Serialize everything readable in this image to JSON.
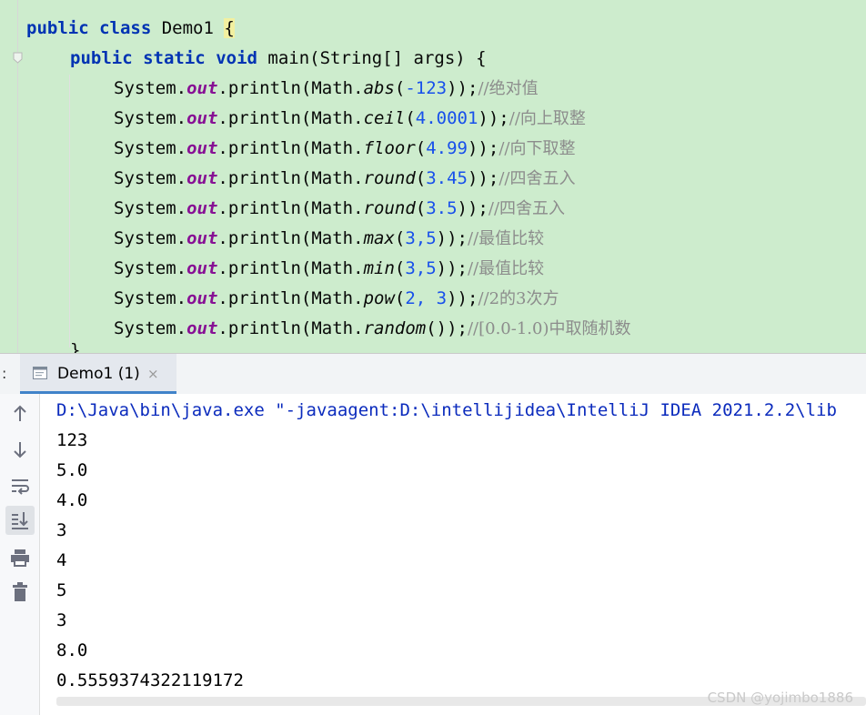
{
  "editor": {
    "class_decl": {
      "kw_public": "public",
      "kw_class": "class",
      "name": " Demo1 ",
      "brace": "{"
    },
    "method_decl": {
      "kw_public": "public",
      "kw_static": "static",
      "kw_void": "void",
      "sig": " main(String[] args) {"
    },
    "statements": [
      {
        "pre": "System.",
        "field": "out",
        "mid": ".println(Math.",
        "method": "abs",
        "open": "(",
        "args": "-123",
        "close": "));",
        "comment": "//绝对值"
      },
      {
        "pre": "System.",
        "field": "out",
        "mid": ".println(Math.",
        "method": "ceil",
        "open": "(",
        "args": "4.0001",
        "close": "));",
        "comment": "//向上取整"
      },
      {
        "pre": "System.",
        "field": "out",
        "mid": ".println(Math.",
        "method": "floor",
        "open": "(",
        "args": "4.99",
        "close": "));",
        "comment": "//向下取整"
      },
      {
        "pre": "System.",
        "field": "out",
        "mid": ".println(Math.",
        "method": "round",
        "open": "(",
        "args": "3.45",
        "close": "));",
        "comment": "//四舍五入"
      },
      {
        "pre": "System.",
        "field": "out",
        "mid": ".println(Math.",
        "method": "round",
        "open": "(",
        "args": "3.5",
        "close": "));",
        "comment": "//四舍五入"
      },
      {
        "pre": "System.",
        "field": "out",
        "mid": ".println(Math.",
        "method": "max",
        "open": "(",
        "args": "3,5",
        "close": "));",
        "comment": "//最值比较"
      },
      {
        "pre": "System.",
        "field": "out",
        "mid": ".println(Math.",
        "method": "min",
        "open": "(",
        "args": "3,5",
        "close": "));",
        "comment": "//最值比较"
      },
      {
        "pre": "System.",
        "field": "out",
        "mid": ".println(Math.",
        "method": "pow",
        "open": "(",
        "args": "2, 3",
        "close": "));",
        "comment": "//2的3次方"
      },
      {
        "pre": "System.",
        "field": "out",
        "mid": ".println(Math.",
        "method": "random",
        "open": "(",
        "args": "",
        "close": "));",
        "comment": "//[0.0-1.0)中取随机数"
      }
    ],
    "partial_close": "}",
    "colors": {
      "background": "#cdeccd",
      "keyword": "#0033b3",
      "field": "#871094",
      "number": "#1750eb",
      "comment": "#8c8c8c"
    }
  },
  "run_panel": {
    "left_fragment": ":",
    "tab_label": "Demo1 (1)",
    "tab_close": "×",
    "tab_icon": "console-window-icon",
    "toolbar_icons": [
      "arrow-up-icon",
      "arrow-down-icon",
      "soft-wrap-icon",
      "scroll-to-end-icon",
      "print-icon",
      "trash-icon"
    ],
    "command": "D:\\Java\\bin\\java.exe \"-javaagent:D:\\intellijidea\\IntelliJ IDEA 2021.2.2\\lib",
    "output": [
      "123",
      "5.0",
      "4.0",
      "3",
      "4",
      "5",
      "3",
      "8.0",
      "0.5559374322119172"
    ]
  },
  "watermark": "CSDN @yojimbo1886"
}
